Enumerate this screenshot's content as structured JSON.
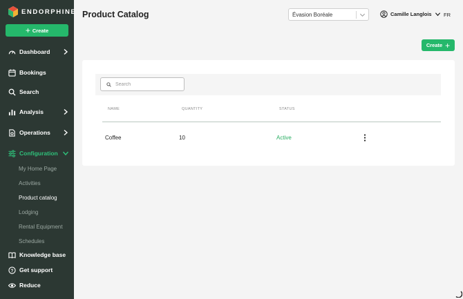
{
  "app": {
    "brand": "ENDORPHINE",
    "page_title": "Product Catalog"
  },
  "sidebar": {
    "create_label": "Create",
    "items": [
      {
        "label": "Dashboard",
        "icon": "speedometer-icon",
        "has_chevron": true
      },
      {
        "label": "Bookings",
        "icon": "calendar-icon",
        "has_chevron": false
      },
      {
        "label": "Search",
        "icon": "search-icon",
        "has_chevron": false
      },
      {
        "label": "Analysis",
        "icon": "bar-chart-icon",
        "has_chevron": true
      },
      {
        "label": "Operations",
        "icon": "operations-icon",
        "has_chevron": true
      },
      {
        "label": "Configuration",
        "icon": "sliders-icon",
        "has_chevron": true,
        "active": true
      }
    ],
    "sub_items": [
      {
        "label": "My Home Page"
      },
      {
        "label": "Activities"
      },
      {
        "label": "Product catalog",
        "current": true
      },
      {
        "label": "Lodging"
      },
      {
        "label": "Rental Equipment"
      },
      {
        "label": "Schedules"
      }
    ],
    "bottom": [
      {
        "label": "Knowledge base",
        "icon": "book-icon"
      },
      {
        "label": "Get support",
        "icon": "help-icon"
      },
      {
        "label": "Reduce",
        "icon": "eye-icon"
      }
    ]
  },
  "header": {
    "organization": "Évasion Boréale",
    "user_name": "Camille Langlois",
    "language": "FR",
    "create_label": "Create"
  },
  "search": {
    "placeholder": "Search",
    "value": ""
  },
  "table": {
    "columns": [
      "NAME",
      "QUANTITY",
      "STATUS"
    ],
    "rows": [
      {
        "name": "Coffee",
        "quantity": "10",
        "status": "Active"
      }
    ]
  },
  "colors": {
    "sidebar_bg": "#2c3833",
    "accent": "#25b86b",
    "active_text": "#2fc07a",
    "status_active": "#2aae63",
    "page_bg": "#f4f4f4"
  }
}
